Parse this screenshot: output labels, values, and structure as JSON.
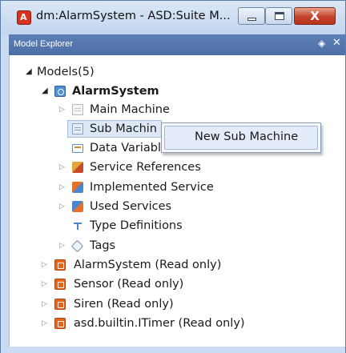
{
  "window": {
    "title": "dm:AlarmSystem - ASD:Suite M...",
    "app_icon_glyph": "A",
    "close_glyph": "X"
  },
  "panel": {
    "title": "Model Explorer",
    "pin_icon_glyph": "◈",
    "close_icon_glyph": "✕"
  },
  "tree": {
    "root_label": "Models(5)",
    "model_label": "AlarmSystem",
    "children": [
      {
        "label": "Main Machine",
        "icon": "doc-icon"
      },
      {
        "label": "Sub Machin",
        "icon": "sub-machine-icon"
      },
      {
        "label": "Data Variables",
        "icon": "data-variables-icon"
      },
      {
        "label": "Service References",
        "icon": "service-references-icon"
      },
      {
        "label": "Implemented Service",
        "icon": "implemented-service-icon"
      },
      {
        "label": "Used Services",
        "icon": "used-services-icon"
      },
      {
        "label": "Type Definitions",
        "icon": "type-definitions-icon"
      },
      {
        "label": "Tags",
        "icon": "tags-icon"
      }
    ],
    "other_models": [
      {
        "label": "AlarmSystem (Read only)"
      },
      {
        "label": "Sensor (Read only)"
      },
      {
        "label": "Siren (Read only)"
      },
      {
        "label": "asd.builtin.ITimer (Read only)"
      }
    ],
    "expand_open_glyph": "◢",
    "expand_closed_glyph": "▷"
  },
  "context_menu": {
    "items": [
      {
        "label": "New Sub Machine"
      }
    ]
  },
  "colors": {
    "panel_header": "#5d7fb6",
    "selection": "#dde8f6",
    "close_button": "#c3432a",
    "model_icon": "#e8641b"
  }
}
